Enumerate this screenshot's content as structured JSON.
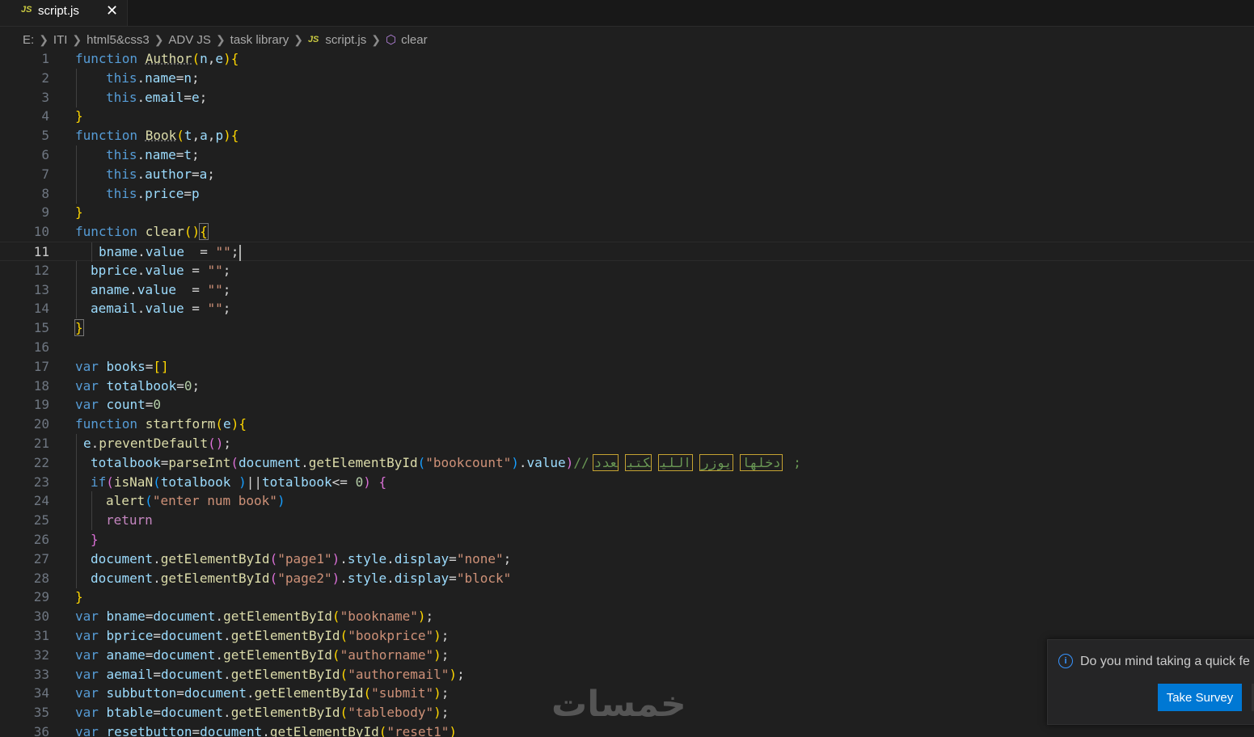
{
  "tab": {
    "icon": "JS",
    "name": "script.js",
    "close": "✕"
  },
  "breadcrumb": {
    "items": [
      "E:",
      "ITI",
      "html5&css3",
      "ADV JS",
      "task library"
    ],
    "file_icon": "JS",
    "file": "script.js",
    "symbol_icon": "cube-icon",
    "symbol": "clear"
  },
  "editor": {
    "line_numbers": [
      "1",
      "2",
      "3",
      "4",
      "5",
      "6",
      "7",
      "8",
      "9",
      "10",
      "11",
      "12",
      "13",
      "14",
      "15",
      "16",
      "17",
      "18",
      "19",
      "20",
      "21",
      "22",
      "23",
      "24",
      "25",
      "26",
      "27",
      "28",
      "29",
      "30",
      "31",
      "32",
      "33",
      "34",
      "35",
      "36"
    ],
    "current_line": 11,
    "arabic_comment_words": [
      "عدد",
      "كتب",
      "اللي",
      "يوزر",
      "دخلها"
    ],
    "colors": {
      "keyword": "#569cd6",
      "function": "#dcdcaa",
      "variable": "#9cdcfe",
      "string": "#ce9178",
      "number": "#b5cea8",
      "comment": "#6a9955"
    }
  },
  "notification": {
    "message": "Do you mind taking a quick fe",
    "button": "Take Survey",
    "icon": "info-icon"
  },
  "watermark": {
    "text": "خمسات"
  }
}
